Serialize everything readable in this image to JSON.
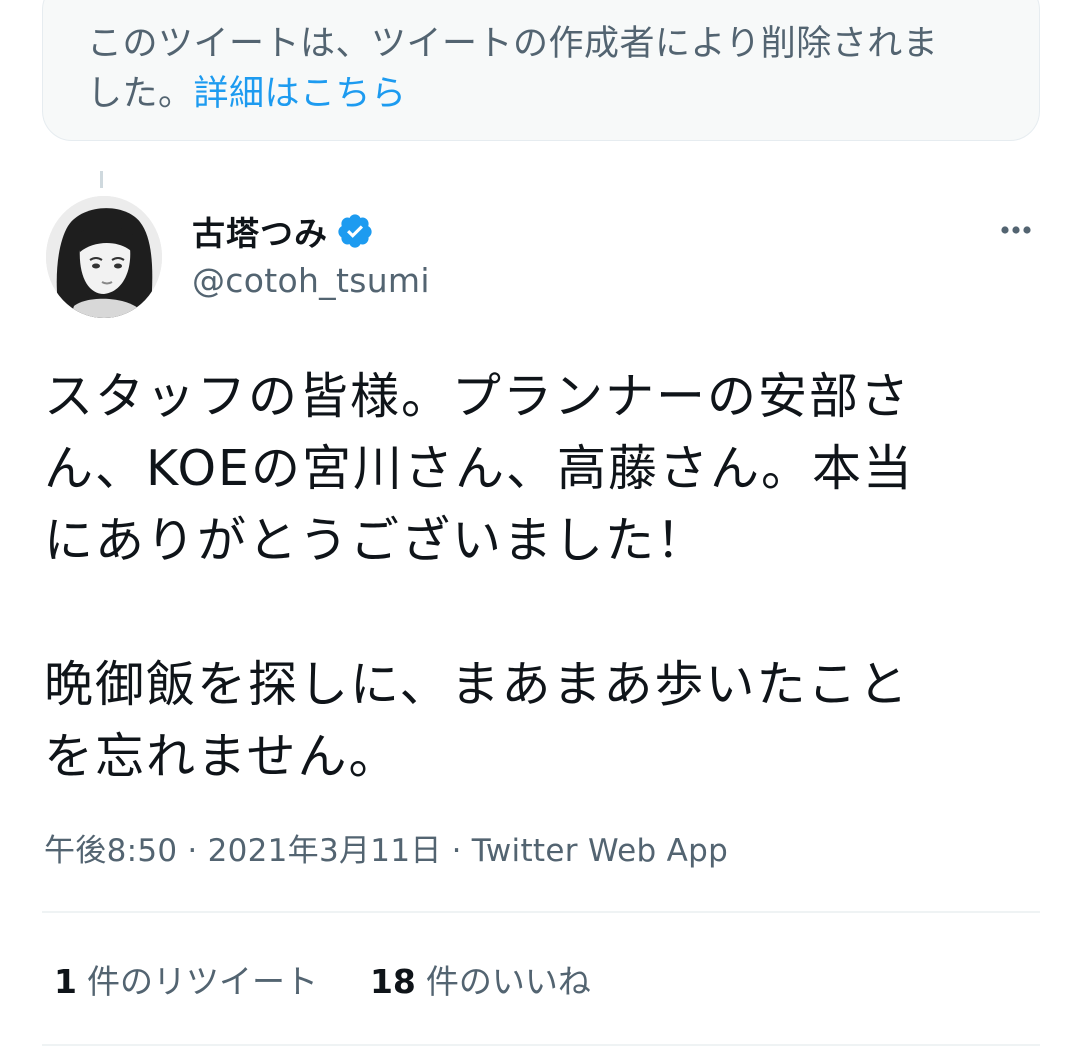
{
  "notice": {
    "text_line1": "このツイートは、ツイートの作成者により削除されま",
    "text_line2": "した。",
    "link": "詳細はこちら"
  },
  "author": {
    "display_name": "古塔つみ",
    "handle": "@cotoh_tsumi",
    "verified": true
  },
  "tweet": {
    "lines_p1": [
      "スタッフの皆様。プランナーの安部さ",
      "ん、KOEの宮川さん、高藤さん。本当",
      "にありがとうございました！"
    ],
    "lines_p2": [
      "晩御飯を探しに、まあまあ歩いたこと",
      "を忘れません。"
    ]
  },
  "meta": {
    "time": "午後8:50",
    "date": "2021年3月11日",
    "source": "Twitter Web App",
    "separator": "·"
  },
  "stats": {
    "retweets_count": "1",
    "retweets_label": "件のリツイート",
    "likes_count": "18",
    "likes_label": "件のいいね"
  },
  "icons": {
    "verified": "verified-badge-icon",
    "more": "more-options-icon"
  },
  "colors": {
    "link": "#1d9bf0",
    "verified": "#1d9bf0",
    "secondary_text": "#536471",
    "primary_text": "#0f1419",
    "notice_bg": "#f7f9f9"
  }
}
